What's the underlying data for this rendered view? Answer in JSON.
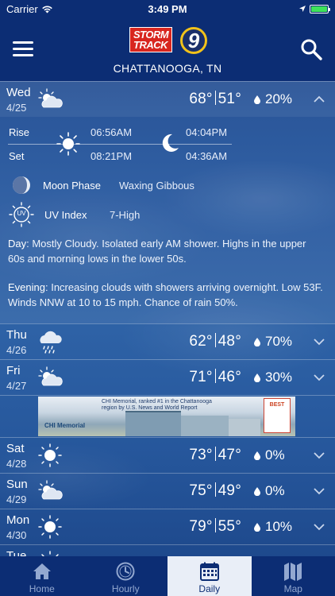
{
  "status_bar": {
    "carrier": "Carrier",
    "time": "3:49 PM",
    "battery_level": 1.0,
    "battery_color": "#3ee25a"
  },
  "header": {
    "logo_text_line1": "STORM",
    "logo_text_line2": "TRACK",
    "logo_number": "9",
    "location": "CHATTANOOGA, TN",
    "menu_icon": "hamburger-menu-icon",
    "search_icon": "search-icon"
  },
  "colors": {
    "header_bg": "#0c2d74",
    "logo_red": "#d8261f",
    "logo_gold": "#f2c21a",
    "active_tab_bg": "#e9eef7"
  },
  "days": [
    {
      "name": "Wed",
      "date": "4/25",
      "high": "68°",
      "low": "51°",
      "rain": "20%",
      "icon": "partly-cloudy-icon",
      "expanded": true
    },
    {
      "name": "Thu",
      "date": "4/26",
      "high": "62°",
      "low": "48°",
      "rain": "70%",
      "icon": "rain-cloud-icon",
      "expanded": false
    },
    {
      "name": "Fri",
      "date": "4/27",
      "high": "71°",
      "low": "46°",
      "rain": "30%",
      "icon": "partly-cloudy-icon",
      "expanded": false
    },
    {
      "name": "Sat",
      "date": "4/28",
      "high": "73°",
      "low": "47°",
      "rain": "0%",
      "icon": "sun-icon",
      "expanded": false
    },
    {
      "name": "Sun",
      "date": "4/29",
      "high": "75°",
      "low": "49°",
      "rain": "0%",
      "icon": "partly-cloudy-icon",
      "expanded": false
    },
    {
      "name": "Mon",
      "date": "4/30",
      "high": "79°",
      "low": "55°",
      "rain": "10%",
      "icon": "sun-icon",
      "expanded": false
    },
    {
      "name": "Tue",
      "date": "",
      "high": "",
      "low": "",
      "rain": "",
      "icon": "sun-icon",
      "expanded": false
    }
  ],
  "detail": {
    "rise_label": "Rise",
    "set_label": "Set",
    "sunrise": "06:56AM",
    "sunset": "08:21PM",
    "moonrise": "04:04PM",
    "moonset": "04:36AM",
    "moon_phase_label": "Moon Phase",
    "moon_phase_value": "Waxing Gibbous",
    "uv_label": "UV Index",
    "uv_value": "7-High",
    "uv_icon_text": "UV",
    "day_label": "Day",
    "day_text": ": Mostly Cloudy. Isolated early AM shower. Highs in the upper 60s and morning lows in the lower 50s.",
    "evening_label": "Evening",
    "evening_text": ": Increasing clouds with showers arriving overnight. Low 53F. Winds NNW at 10 to 15 mph. Chance of rain 50%."
  },
  "ad": {
    "headline": "CHI Memorial, ranked #1 in the Chattanooga region by U.S. News and World Report",
    "brand": "CHI Memorial",
    "badge": "BEST"
  },
  "tabs": [
    {
      "label": "Home",
      "icon": "home-icon",
      "active": false
    },
    {
      "label": "Hourly",
      "icon": "clock-icon",
      "active": false
    },
    {
      "label": "Daily",
      "icon": "calendar-icon",
      "active": true
    },
    {
      "label": "Map",
      "icon": "map-icon",
      "active": false
    }
  ]
}
